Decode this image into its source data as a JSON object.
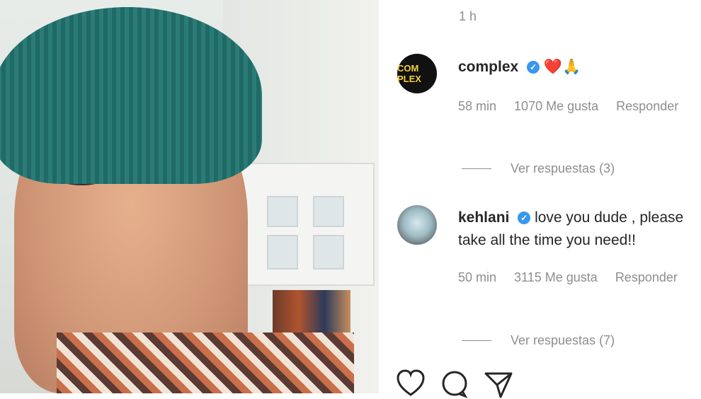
{
  "post": {
    "time": "1 h"
  },
  "comments": [
    {
      "username": "complex",
      "avatar_text": "COM PLEX",
      "emoji": "❤️🙏",
      "age": "58 min",
      "likes": "1070 Me gusta",
      "reply": "Responder",
      "view_replies": "Ver respuestas (3)"
    },
    {
      "username": "kehlani",
      "text_line1": "love you dude , please",
      "text_line2": "take all the time you need!!",
      "age": "50 min",
      "likes": "3115 Me gusta",
      "reply": "Responder",
      "view_replies": "Ver respuestas (7)"
    }
  ],
  "icons": [
    "heart-icon",
    "comment-icon",
    "share-icon"
  ],
  "colors": {
    "verified": "#3897f0",
    "meta": "#8e8e8e",
    "text": "#262626"
  }
}
